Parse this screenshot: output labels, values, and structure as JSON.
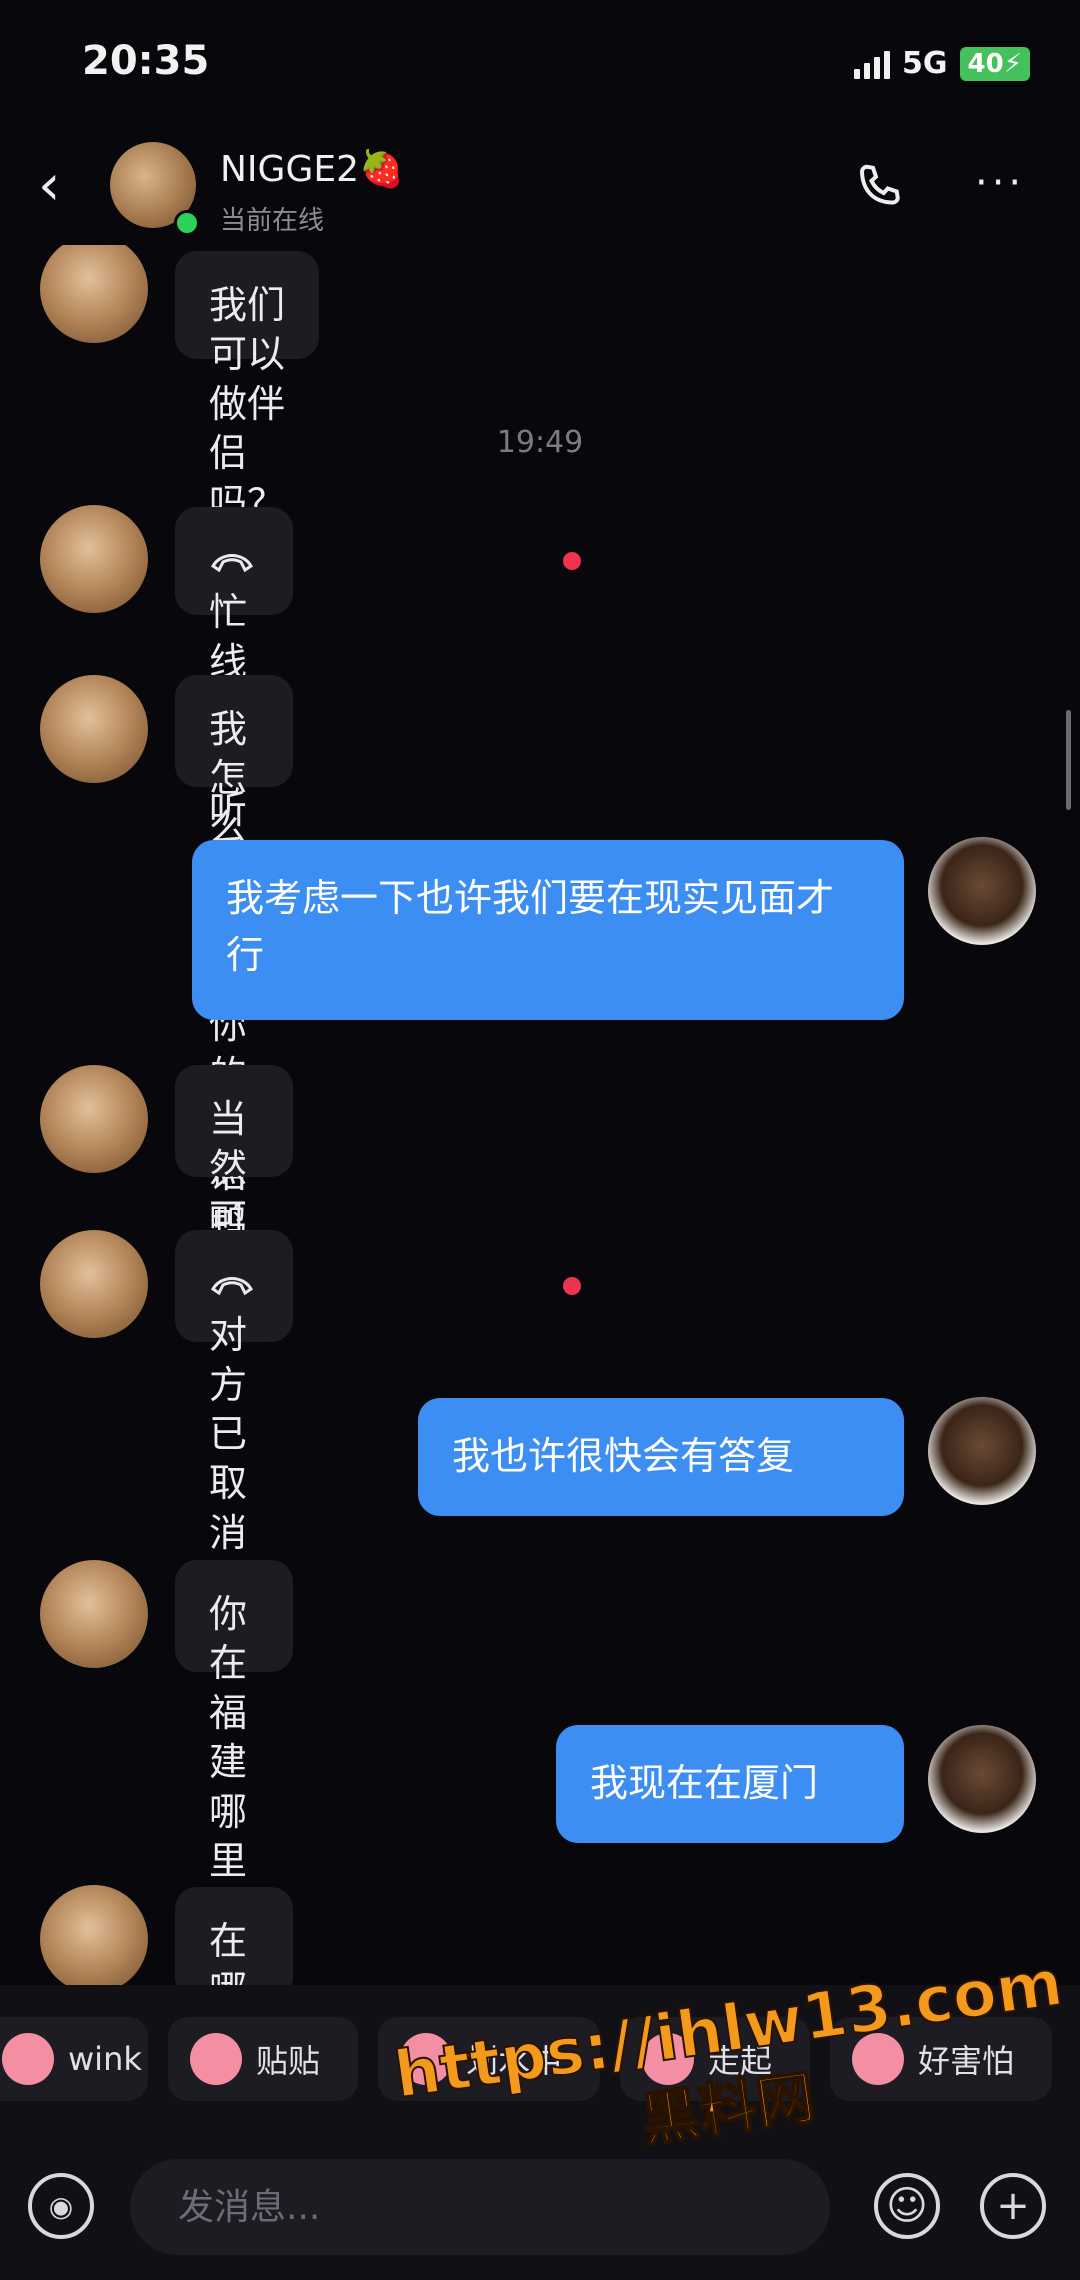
{
  "status_bar": {
    "time": "20:35",
    "network": "5G",
    "battery": "40"
  },
  "header": {
    "contact_name": "NIGGE2🍓",
    "contact_status": "当前在线"
  },
  "messages": [
    {
      "from": "them",
      "text": "我们可以做伴侣吗？"
    },
    {
      "type": "time",
      "text": "19:49"
    },
    {
      "from": "them",
      "type": "call",
      "text": "忙线未接听"
    },
    {
      "from": "them",
      "text": "我怎么打不了你的电话鸭"
    },
    {
      "from": "me",
      "text": "我考虑一下也许我们要在现实见面才行"
    },
    {
      "from": "them",
      "text": "当然可以"
    },
    {
      "from": "them",
      "type": "call",
      "text": "对方已取消"
    },
    {
      "from": "me",
      "text": "我也许很快会有答复"
    },
    {
      "from": "them",
      "text": "你在福建哪里鸭"
    },
    {
      "from": "me",
      "text": "我现在在厦门"
    },
    {
      "from": "them",
      "text": "在哪里鸭"
    }
  ],
  "quick_replies": [
    "wink",
    "贴贴",
    "划水中",
    "走起",
    "好害怕"
  ],
  "input": {
    "placeholder": "发消息..."
  },
  "watermark": {
    "url": "https://ihlw13.com",
    "name": "黑料网"
  },
  "colors": {
    "background": "#08080c",
    "incoming_bubble": "#1c1c22",
    "outgoing_bubble": "#3d8ef3",
    "unread_dot": "#f0334e",
    "online": "#2bd15a"
  }
}
